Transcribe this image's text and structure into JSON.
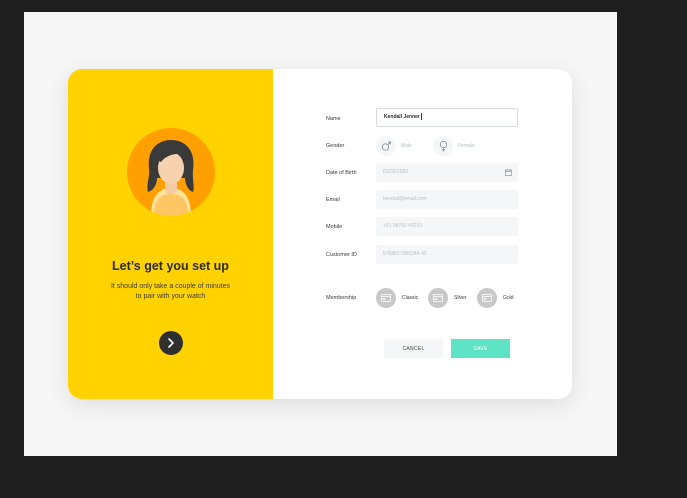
{
  "welcome": {
    "title": "Let’s get you set up",
    "subtitle_line1": "It should only take a couple of minutes",
    "subtitle_line2": "to pair with your watch"
  },
  "form": {
    "name": {
      "label": "Name",
      "value": "Kendall Jenner"
    },
    "gender": {
      "label": "Gender",
      "options": [
        {
          "label": "Male",
          "icon": "male-icon"
        },
        {
          "label": "Female",
          "icon": "female-icon"
        }
      ]
    },
    "dob": {
      "label": "Date of Birth",
      "placeholder": "01/02/1983",
      "icon": "calendar-icon"
    },
    "email": {
      "label": "Email",
      "placeholder": "kendall@email.com"
    },
    "mobile": {
      "label": "Mobile",
      "placeholder": "+91 98765 43210"
    },
    "customer_id": {
      "label": "Customer ID",
      "placeholder": "576862-DB8348-45"
    },
    "membership": {
      "label": "Membership",
      "options": [
        {
          "label": "Classic",
          "icon": "card-icon"
        },
        {
          "label": "Silver",
          "icon": "card-icon"
        },
        {
          "label": "Gold",
          "icon": "card-icon"
        }
      ]
    }
  },
  "actions": {
    "cancel": "CANCEL",
    "save": "SAVE"
  },
  "colors": {
    "panel": "#ffd200",
    "avatar_bg": "#ff9f00",
    "save": "#5ee3c5",
    "field_bg": "#f4f6f8",
    "background": "#1e1e1e"
  }
}
